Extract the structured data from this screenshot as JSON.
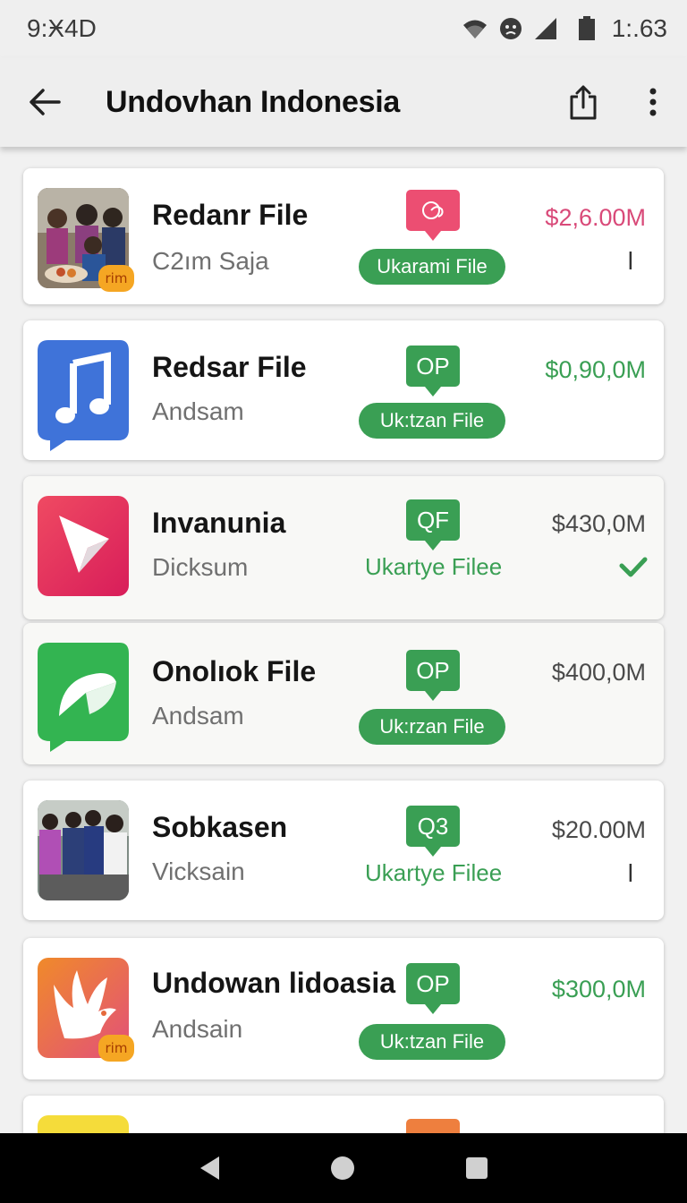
{
  "status_bar": {
    "time": "9:Ӿ4D",
    "clock_right": "1:.63"
  },
  "app_bar": {
    "title": "Undovhan Indonesia"
  },
  "items": [
    {
      "title": "Redanr File",
      "subtitle": "C2ım Saja",
      "tag": "",
      "tag_icon": "swirl-icon",
      "tag_color": "#ec4e72",
      "action": "Ukarami File",
      "action_style": "pill",
      "price": "$2,6.00M",
      "price_color": "pink",
      "trail": "l",
      "thumb": "photo-people",
      "badge": "rim"
    },
    {
      "title": "Redsar File",
      "subtitle": "Andsam",
      "tag": "OP",
      "tag_color": "#3a9f54",
      "action": "Uk:tzan File",
      "action_style": "pill",
      "price": "$0,90,0M",
      "price_color": "green",
      "trail": "",
      "thumb": "music-icon-tile"
    },
    {
      "title": "Invanunia",
      "subtitle": "Dicksum",
      "tag": "QF",
      "tag_color": "#3a9f54",
      "action": "Ukartye Filee",
      "action_style": "text",
      "price": "$430,0M",
      "price_color": "gray",
      "trail": "check",
      "thumb": "cursor-icon-tile"
    },
    {
      "title": "Onolıok File",
      "subtitle": "Andsam",
      "tag": "OP",
      "tag_color": "#3a9f54",
      "action": "Uk:rzan File",
      "action_style": "pill",
      "price": "$400,0M",
      "price_color": "gray",
      "trail": "",
      "thumb": "chat-icon-tile"
    },
    {
      "title": "Sobkasen",
      "subtitle": "Vicksain",
      "tag": "Q3",
      "tag_color": "#3a9f54",
      "action": "Ukartye Filee",
      "action_style": "text",
      "price": "$20.00M",
      "price_color": "gray",
      "trail": "l",
      "thumb": "photo-group"
    },
    {
      "title": "Undowan lidoasia",
      "subtitle": "Andsain",
      "tag": "OP",
      "tag_color": "#3a9f54",
      "action": "Uk:tzan File",
      "action_style": "pill",
      "price": "$300,0M",
      "price_color": "green",
      "trail": "",
      "thumb": "bird-icon-tile",
      "badge": "rim"
    }
  ],
  "colors": {
    "accent_green": "#3a9f54",
    "accent_pink": "#ec4e72",
    "price_pink": "#d94a79"
  }
}
